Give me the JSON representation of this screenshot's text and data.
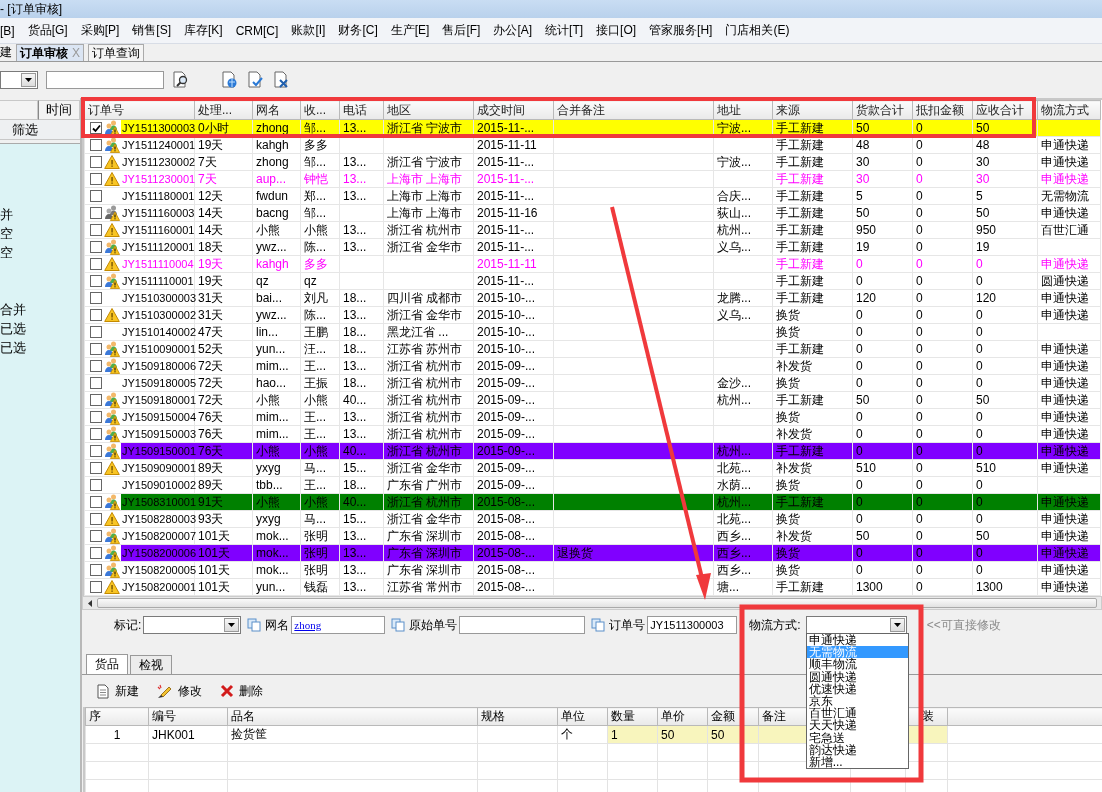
{
  "window": {
    "title": "- [订单审核]"
  },
  "menu": [
    "[B]",
    "货品[G]",
    "采购[P]",
    "销售[S]",
    "库存[K]",
    "CRM[C]",
    "账款[I]",
    "财务[C]",
    "生产[E]",
    "售后[F]",
    "办公[A]",
    "统计[T]",
    "接口[O]",
    "管家服务[H]",
    "门店相关(E)"
  ],
  "tabs": [
    {
      "label": "建",
      "selected": false
    },
    {
      "label": "订单审核",
      "selected": true,
      "close": "X"
    },
    {
      "label": "订单查询",
      "selected": false
    }
  ],
  "sidebar": {
    "header": "时间",
    "filter_button": "筛选",
    "items": [
      "并",
      "空",
      "空",
      "合并",
      "已选",
      "已选"
    ]
  },
  "grid": {
    "columns": [
      "订单号",
      "处理...",
      "网名",
      "收...",
      "电话",
      "地区",
      "成交时间",
      "合并备注",
      "地址",
      "来源",
      "货款合计",
      "抵扣金额",
      "应收合计",
      "物流方式"
    ],
    "rows": [
      {
        "checked": true,
        "selected": true,
        "kind": "plain",
        "warning": true,
        "assigned": true,
        "locked": false,
        "id": "JY1511300003",
        "age": "0小时",
        "nick": "zhong",
        "name": "邹...",
        "phone": "13...",
        "region": "浙江省 宁波市",
        "date": "2015-11-...",
        "address": "宁波...",
        "source": "手工新建",
        "goods": "50",
        "deduct": "0",
        "total": "50"
      },
      {
        "checked": false,
        "selected": false,
        "kind": "plain",
        "warning": true,
        "assigned": true,
        "locked": false,
        "id": "JY1511240001",
        "age": "19天",
        "nick": "kahgh",
        "name": "多多",
        "date": "2015-11-11",
        "source": "手工新建",
        "goods": "48",
        "deduct": "0",
        "total": "48",
        "logistics": "申通快递"
      },
      {
        "checked": false,
        "selected": false,
        "kind": "plain",
        "warning": true,
        "assigned": false,
        "locked": false,
        "id": "JY1511230002",
        "age": "7天",
        "nick": "zhong",
        "name": "邹...",
        "phone": "13...",
        "region": "浙江省 宁波市",
        "date": "2015-11-...",
        "address": "宁波...",
        "source": "手工新建",
        "goods": "30",
        "deduct": "0",
        "total": "30",
        "logistics": "申通快递"
      },
      {
        "checked": false,
        "selected": false,
        "kind": "magenta",
        "warning": true,
        "assigned": false,
        "locked": false,
        "id": "JY1511230001",
        "age": "7天",
        "nick": "aup...",
        "name": "钟恺",
        "phone": "13...",
        "region": "上海市 上海市",
        "date": "2015-11-...",
        "source": "手工新建",
        "goods": "30",
        "deduct": "0",
        "total": "30",
        "logistics": "申通快递"
      },
      {
        "checked": false,
        "selected": false,
        "kind": "plain",
        "warning": false,
        "assigned": false,
        "locked": false,
        "id": "JY1511180001",
        "age": "12天",
        "nick": "fwdun",
        "name": "郑...",
        "phone": "13...",
        "region": "上海市 上海市",
        "date": "2015-11-...",
        "address": "合庆...",
        "source": "手工新建",
        "goods": "5",
        "deduct": "0",
        "total": "5",
        "logistics": "无需物流"
      },
      {
        "checked": false,
        "selected": false,
        "kind": "plain",
        "warning": true,
        "assigned": false,
        "locked": true,
        "id": "JY1511160003",
        "age": "14天",
        "nick": "bacng",
        "name": "邹...",
        "region": "上海市 上海市",
        "date": "2015-11-16",
        "address": "荻山...",
        "source": "手工新建",
        "goods": "50",
        "deduct": "0",
        "total": "50",
        "logistics": "申通快递"
      },
      {
        "checked": false,
        "selected": false,
        "kind": "plain",
        "warning": true,
        "assigned": false,
        "locked": false,
        "id": "JY1511160001",
        "age": "14天",
        "nick": "小熊",
        "name": "小熊",
        "phone": "13...",
        "region": "浙江省 杭州市",
        "date": "2015-11-...",
        "address": "杭州...",
        "source": "手工新建",
        "goods": "950",
        "deduct": "0",
        "total": "950",
        "logistics": "百世汇通"
      },
      {
        "checked": false,
        "selected": false,
        "kind": "plain",
        "warning": true,
        "assigned": true,
        "locked": false,
        "id": "JY1511120001",
        "age": "18天",
        "nick": "ywz...",
        "name": "陈...",
        "phone": "13...",
        "region": "浙江省 金华市",
        "date": "2015-11-...",
        "address": "义乌...",
        "source": "手工新建",
        "goods": "19",
        "deduct": "0",
        "total": "19"
      },
      {
        "checked": false,
        "selected": false,
        "kind": "magenta",
        "warning": true,
        "assigned": false,
        "locked": false,
        "id": "JY1511110004",
        "age": "19天",
        "nick": "kahgh",
        "name": "多多",
        "date": "2015-11-11",
        "source": "手工新建",
        "goods": "0",
        "deduct": "0",
        "total": "0",
        "logistics": "申通快递"
      },
      {
        "checked": false,
        "selected": false,
        "kind": "plain",
        "warning": true,
        "assigned": true,
        "locked": false,
        "id": "JY1511110001",
        "age": "19天",
        "nick": "qz",
        "name": "qz",
        "date": "2015-11-...",
        "source": "手工新建",
        "goods": "0",
        "deduct": "0",
        "total": "0",
        "logistics": "圆通快递"
      },
      {
        "checked": false,
        "selected": false,
        "kind": "plain",
        "warning": false,
        "assigned": false,
        "locked": false,
        "id": "JY1510300003",
        "age": "31天",
        "nick": "bai...",
        "name": "刘凡",
        "phone": "18...",
        "region": "四川省 成都市",
        "date": "2015-10-...",
        "address": "龙腾...",
        "source": "手工新建",
        "goods": "120",
        "deduct": "0",
        "total": "120",
        "logistics": "申通快递"
      },
      {
        "checked": false,
        "selected": false,
        "kind": "plain",
        "warning": true,
        "assigned": false,
        "locked": false,
        "id": "JY1510300002",
        "age": "31天",
        "nick": "ywz...",
        "name": "陈...",
        "phone": "13...",
        "region": "浙江省 金华市",
        "date": "2015-10-...",
        "address": "义乌...",
        "source": "换货",
        "goods": "0",
        "deduct": "0",
        "total": "0",
        "logistics": "申通快递"
      },
      {
        "checked": false,
        "selected": false,
        "kind": "plain",
        "warning": false,
        "assigned": false,
        "locked": false,
        "id": "JY1510140002",
        "age": "47天",
        "nick": "lin...",
        "name": "王鹏",
        "phone": "18...",
        "region": "黑龙江省 ...",
        "date": "2015-10-...",
        "source": "换货",
        "goods": "0",
        "deduct": "0",
        "total": "0"
      },
      {
        "checked": false,
        "selected": false,
        "kind": "plain",
        "warning": true,
        "assigned": true,
        "locked": false,
        "id": "JY1510090001",
        "age": "52天",
        "nick": "yun...",
        "name": "汪...",
        "phone": "18...",
        "region": "江苏省 苏州市",
        "date": "2015-10-...",
        "source": "手工新建",
        "goods": "0",
        "deduct": "0",
        "total": "0",
        "logistics": "申通快递"
      },
      {
        "checked": false,
        "selected": false,
        "kind": "plain",
        "warning": true,
        "assigned": true,
        "locked": false,
        "id": "JY1509180006",
        "age": "72天",
        "nick": "mim...",
        "name": "王...",
        "phone": "13...",
        "region": "浙江省 杭州市",
        "date": "2015-09-...",
        "source": "补发货",
        "goods": "0",
        "deduct": "0",
        "total": "0",
        "logistics": "申通快递"
      },
      {
        "checked": false,
        "selected": false,
        "kind": "plain",
        "warning": false,
        "assigned": false,
        "locked": false,
        "id": "JY1509180005",
        "age": "72天",
        "nick": "hao...",
        "name": "王振",
        "phone": "18...",
        "region": "浙江省 杭州市",
        "date": "2015-09-...",
        "address": "金沙...",
        "source": "换货",
        "goods": "0",
        "deduct": "0",
        "total": "0",
        "logistics": "申通快递"
      },
      {
        "checked": false,
        "selected": false,
        "kind": "plain",
        "warning": true,
        "assigned": true,
        "locked": false,
        "id": "JY1509180001",
        "age": "72天",
        "nick": "小熊",
        "name": "小熊",
        "phone": "40...",
        "region": "浙江省 杭州市",
        "date": "2015-09-...",
        "address": "杭州...",
        "source": "手工新建",
        "goods": "50",
        "deduct": "0",
        "total": "50",
        "logistics": "申通快递"
      },
      {
        "checked": false,
        "selected": false,
        "kind": "plain",
        "warning": true,
        "assigned": true,
        "locked": false,
        "id": "JY1509150004",
        "age": "76天",
        "nick": "mim...",
        "name": "王...",
        "phone": "13...",
        "region": "浙江省 杭州市",
        "date": "2015-09-...",
        "source": "换货",
        "goods": "0",
        "deduct": "0",
        "total": "0",
        "logistics": "申通快递"
      },
      {
        "checked": false,
        "selected": false,
        "kind": "plain",
        "warning": true,
        "assigned": true,
        "locked": false,
        "id": "JY1509150003",
        "age": "76天",
        "nick": "mim...",
        "name": "王...",
        "phone": "13...",
        "region": "浙江省 杭州市",
        "date": "2015-09-...",
        "source": "补发货",
        "goods": "0",
        "deduct": "0",
        "total": "0",
        "logistics": "申通快递"
      },
      {
        "checked": false,
        "selected": false,
        "kind": "purple",
        "warning": true,
        "assigned": true,
        "locked": false,
        "id": "JY1509150001",
        "age": "76天",
        "nick": "小熊",
        "name": "小熊",
        "phone": "40...",
        "region": "浙江省 杭州市",
        "date": "2015-09-...",
        "address": "杭州...",
        "source": "手工新建",
        "goods": "0",
        "deduct": "0",
        "total": "0",
        "logistics": "申通快递"
      },
      {
        "checked": false,
        "selected": false,
        "kind": "plain",
        "warning": true,
        "assigned": false,
        "locked": false,
        "id": "JY1509090001",
        "age": "89天",
        "nick": "yxyg",
        "name": "马...",
        "phone": "15...",
        "region": "浙江省 金华市",
        "date": "2015-09-...",
        "address": "北苑...",
        "source": "补发货",
        "goods": "510",
        "deduct": "0",
        "total": "510",
        "logistics": "申通快递"
      },
      {
        "checked": false,
        "selected": false,
        "kind": "plain",
        "warning": false,
        "assigned": false,
        "locked": false,
        "id": "JY1509010002",
        "age": "89天",
        "nick": "tbb...",
        "name": "王...",
        "phone": "18...",
        "region": "广东省 广州市",
        "date": "2015-09-...",
        "address": "水荫...",
        "source": "换货",
        "goods": "0",
        "deduct": "0",
        "total": "0"
      },
      {
        "checked": false,
        "selected": false,
        "kind": "green",
        "warning": true,
        "assigned": true,
        "locked": false,
        "id": "JY1508310001",
        "age": "91天",
        "nick": "小熊",
        "name": "小熊",
        "phone": "40...",
        "region": "浙江省 杭州市",
        "date": "2015-08-...",
        "address": "杭州...",
        "source": "手工新建",
        "goods": "0",
        "deduct": "0",
        "total": "0",
        "logistics": "申通快递"
      },
      {
        "checked": false,
        "selected": false,
        "kind": "plain",
        "warning": true,
        "assigned": false,
        "locked": false,
        "id": "JY1508280003",
        "age": "93天",
        "nick": "yxyg",
        "name": "马...",
        "phone": "15...",
        "region": "浙江省 金华市",
        "date": "2015-08-...",
        "address": "北苑...",
        "source": "换货",
        "goods": "0",
        "deduct": "0",
        "total": "0",
        "logistics": "申通快递"
      },
      {
        "checked": false,
        "selected": false,
        "kind": "plain",
        "warning": true,
        "assigned": true,
        "locked": false,
        "id": "JY1508200007",
        "age": "101天",
        "nick": "mok...",
        "name": "张明",
        "phone": "13...",
        "region": "广东省 深圳市",
        "date": "2015-08-...",
        "address": "西乡...",
        "source": "补发货",
        "goods": "50",
        "deduct": "0",
        "total": "50",
        "logistics": "申通快递"
      },
      {
        "checked": false,
        "selected": false,
        "kind": "purple",
        "warning": true,
        "assigned": true,
        "locked": false,
        "id": "JY1508200006",
        "age": "101天",
        "nick": "mok...",
        "name": "张明",
        "phone": "13...",
        "region": "广东省 深圳市",
        "date": "2015-08-...",
        "remark": "退换货",
        "address": "西乡...",
        "source": "换货",
        "goods": "0",
        "deduct": "0",
        "total": "0",
        "logistics": "申通快递"
      },
      {
        "checked": false,
        "selected": false,
        "kind": "plain",
        "warning": true,
        "assigned": true,
        "locked": false,
        "id": "JY1508200005",
        "age": "101天",
        "nick": "mok...",
        "name": "张明",
        "phone": "13...",
        "region": "广东省 深圳市",
        "date": "2015-08-...",
        "address": "西乡...",
        "source": "换货",
        "goods": "0",
        "deduct": "0",
        "total": "0",
        "logistics": "申通快递"
      },
      {
        "checked": false,
        "selected": false,
        "kind": "plain",
        "warning": true,
        "assigned": false,
        "locked": false,
        "id": "JY1508200001",
        "age": "101天",
        "nick": "yun...",
        "name": "钱磊",
        "phone": "13...",
        "region": "江苏省 常州市",
        "date": "2015-08-...",
        "address": "塘...",
        "source": "手工新建",
        "goods": "1300",
        "deduct": "0",
        "total": "1300",
        "logistics": "申通快递"
      }
    ]
  },
  "form": {
    "mark_label": "标记:",
    "nick_label": "网名",
    "nick_value": "zhong",
    "source_label": "原始单号",
    "order_label": "订单号",
    "order_value": "JY1511300003",
    "logistics_label": "物流方式:",
    "hint": "<<可直接修改"
  },
  "logistics_options": [
    {
      "label": "申通快递",
      "selected": false
    },
    {
      "label": "无需物流",
      "selected": true
    },
    {
      "label": "顺丰物流",
      "selected": false
    },
    {
      "label": "圆通快递",
      "selected": false
    },
    {
      "label": "优速快递",
      "selected": false
    },
    {
      "label": "京东",
      "selected": false
    },
    {
      "label": "百世汇通",
      "selected": false
    },
    {
      "label": "天天快递",
      "selected": false
    },
    {
      "label": "宅急送",
      "selected": false
    },
    {
      "label": "韵达快递",
      "selected": false
    },
    {
      "label": "新增...",
      "selected": false
    }
  ],
  "subtabs": [
    {
      "label": "货品",
      "selected": true
    },
    {
      "label": "检视",
      "selected": false
    }
  ],
  "detail_toolbar": [
    {
      "label": "新建",
      "kind": "new"
    },
    {
      "label": "修改",
      "kind": "edit"
    },
    {
      "label": "删除",
      "kind": "delete"
    }
  ],
  "detail": {
    "columns": [
      "序",
      "编号",
      "品名",
      "规格",
      "单位",
      "数量",
      "单价",
      "金额",
      "备注",
      "装"
    ],
    "rows": [
      {
        "index": "1",
        "code": "JHK001",
        "name": "捡货筐",
        "unit": "个",
        "qty": "1",
        "price": "50",
        "amount": "50"
      }
    ]
  }
}
